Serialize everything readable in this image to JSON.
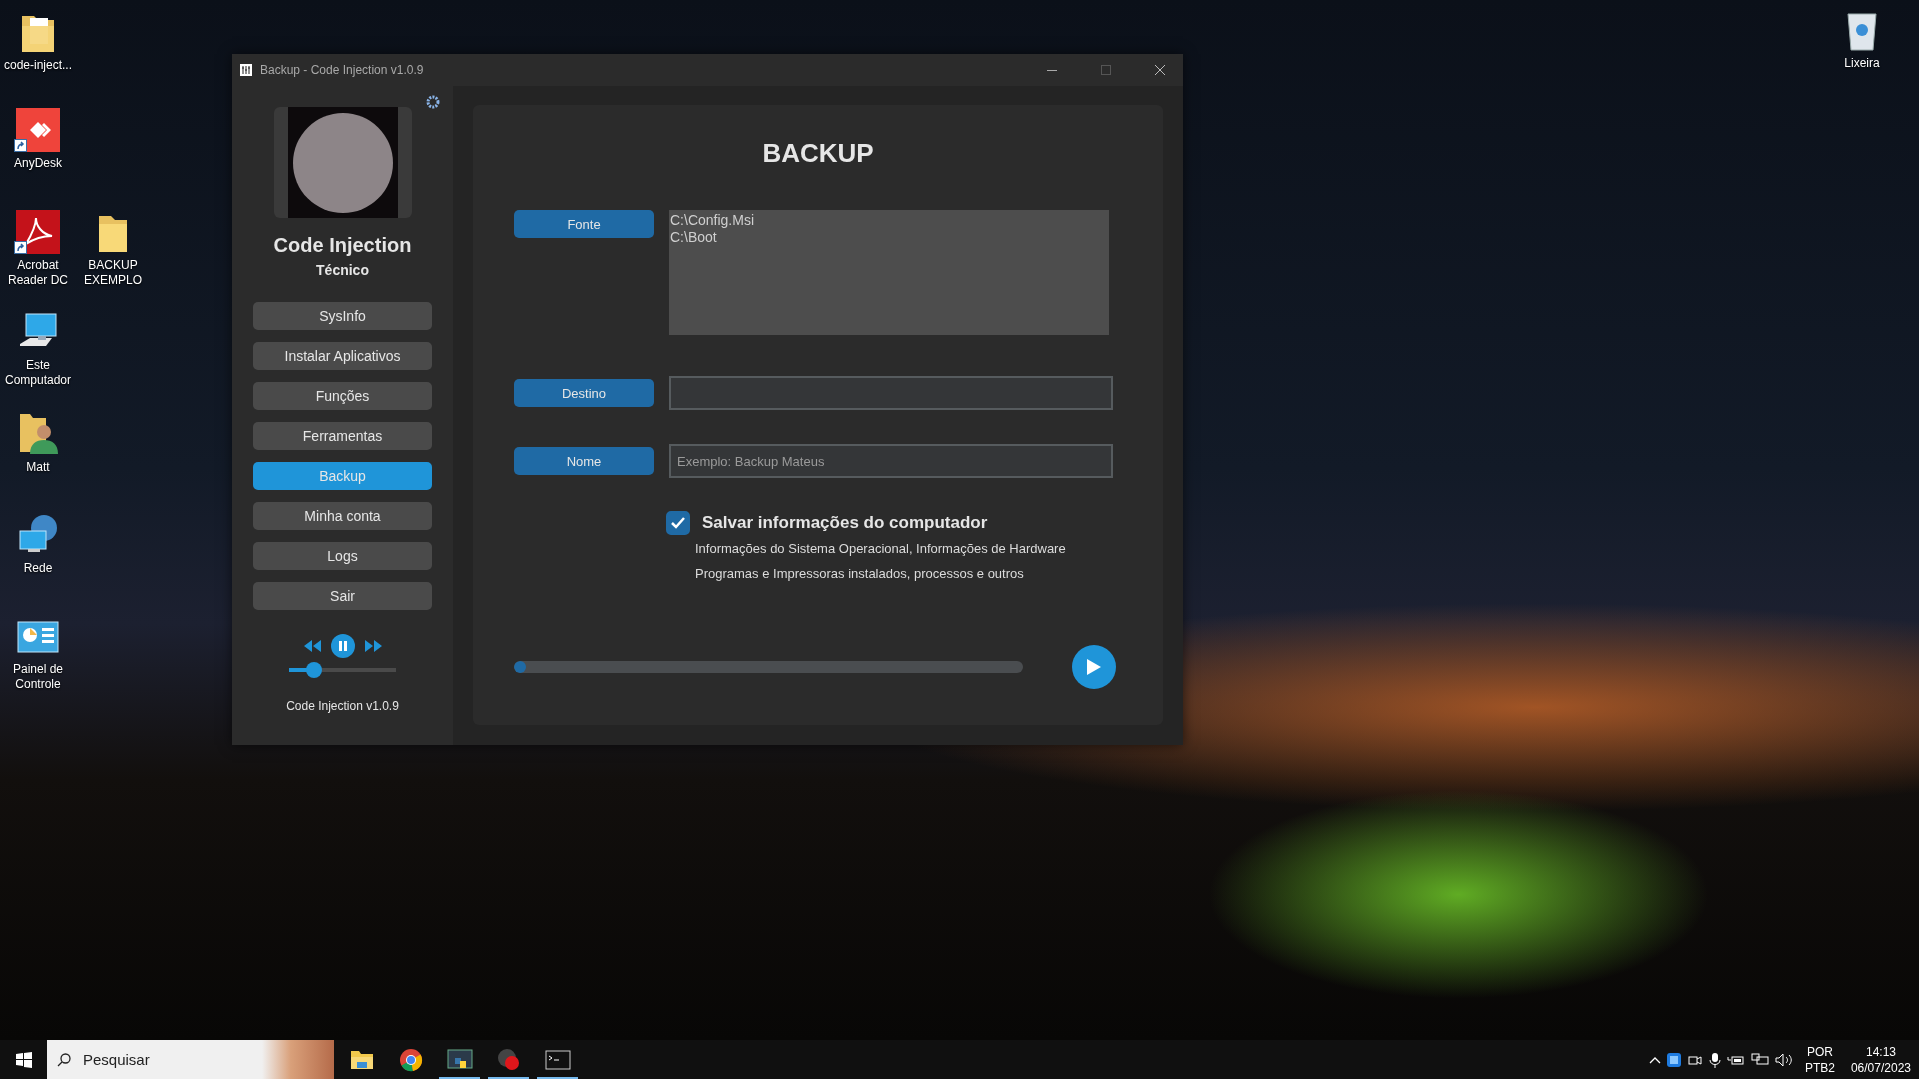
{
  "desktop": {
    "icons": [
      {
        "label": "code-inject...",
        "kind": "doc-folder",
        "shortcut": false
      },
      {
        "label": "AnyDesk",
        "kind": "remote-app",
        "shortcut": true
      },
      {
        "label": "Acrobat Reader DC",
        "kind": "pdf-app",
        "shortcut": true
      },
      {
        "label": "BACKUP EXEMPLO",
        "kind": "folder",
        "shortcut": false
      },
      {
        "label": "Este Computador",
        "kind": "computer",
        "shortcut": false
      },
      {
        "label": "Matt",
        "kind": "user-folder",
        "shortcut": false
      },
      {
        "label": "Rede",
        "kind": "network",
        "shortcut": false
      },
      {
        "label": "Painel de Controle",
        "kind": "control-panel",
        "shortcut": false
      },
      {
        "label": "Lixeira",
        "kind": "recycle-bin",
        "shortcut": false
      }
    ]
  },
  "window": {
    "title": "Backup - Code Injection v1.0.9",
    "sidebar": {
      "name": "Code Injection",
      "role": "Técnico",
      "nav": [
        {
          "label": "SysInfo",
          "selected": false
        },
        {
          "label": "Instalar Aplicativos",
          "selected": false
        },
        {
          "label": "Funções",
          "selected": false
        },
        {
          "label": "Ferramentas",
          "selected": false
        },
        {
          "label": "Backup",
          "selected": true
        },
        {
          "label": "Minha conta",
          "selected": false
        },
        {
          "label": "Logs",
          "selected": false
        },
        {
          "label": "Sair",
          "selected": false
        }
      ],
      "player": {
        "playing": true,
        "volume": {
          "level": 0.23
        }
      },
      "version": "Code Injection v1.0.9"
    },
    "main": {
      "title": "BACKUP",
      "rows": [
        {
          "kind": "list",
          "button": "Fonte",
          "items": [
            "C:\\Config.Msi",
            "C:\\Boot"
          ]
        },
        {
          "kind": "entry",
          "button": "Destino"
        },
        {
          "kind": "entry",
          "button": "Nome",
          "placeholder": "Exemplo: Backup Mateus"
        }
      ],
      "option": {
        "label": "Salvar informações do computador",
        "checked": true,
        "details": [
          "Informações do Sistema Operacional, Informações de Hardware",
          "Programas e Impressoras instalados, processos e outros"
        ]
      },
      "progress": {
        "level": 0.02
      }
    }
  },
  "taskbar": {
    "search": {
      "placeholder": "Pesquisar"
    },
    "apps": [
      {
        "kind": "folder",
        "running": false
      },
      {
        "kind": "ring-logo",
        "running": false
      },
      {
        "kind": "code-window",
        "running": true
      },
      {
        "kind": "record",
        "running": true
      },
      {
        "kind": "terminal",
        "running": true
      }
    ],
    "language": "POR",
    "layout": "PTB2",
    "time": "14:13",
    "date": "06/07/2023"
  }
}
